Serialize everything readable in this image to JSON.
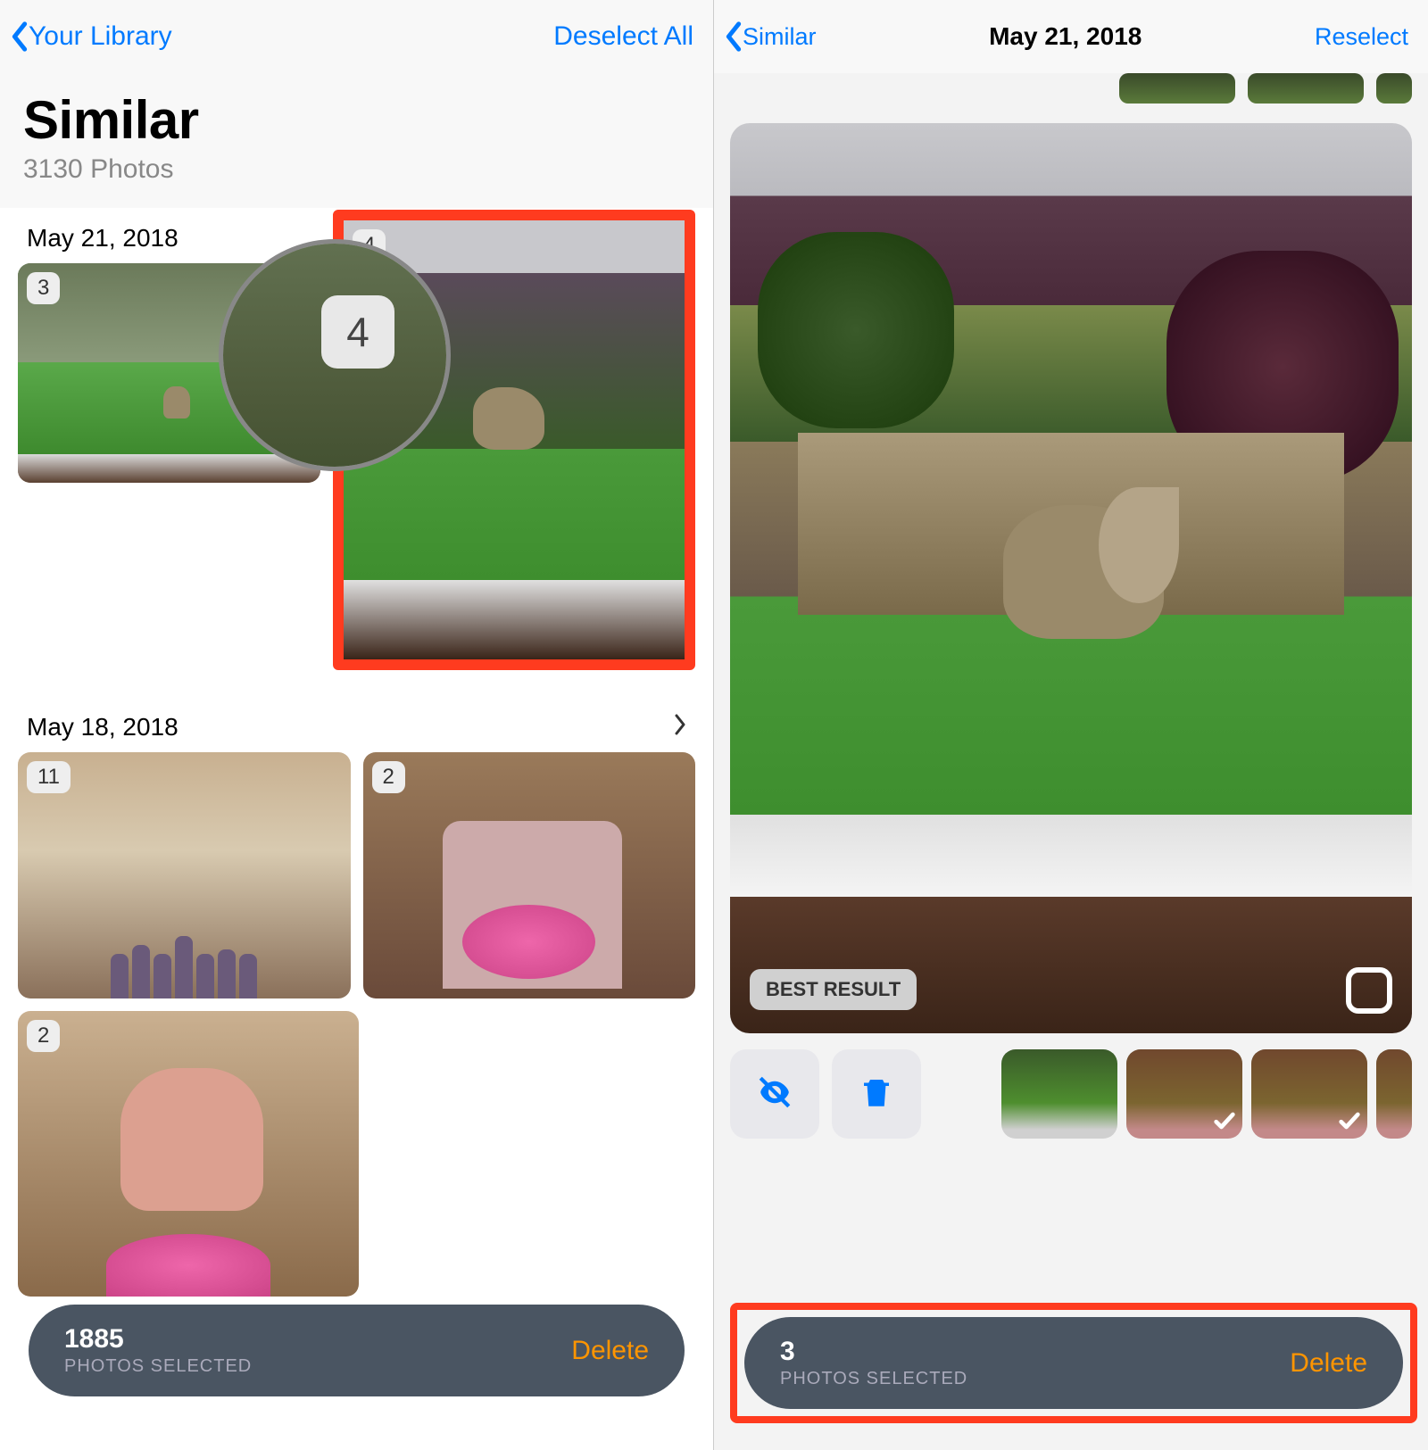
{
  "left": {
    "nav": {
      "back": "Your Library",
      "action": "Deselect All"
    },
    "hero": {
      "title": "Similar",
      "subtitle": "3130 Photos"
    },
    "sections": [
      {
        "date": "May 21, 2018",
        "thumbs": [
          {
            "count": "3"
          },
          {
            "count": "4"
          }
        ],
        "magnifier_count": "4"
      },
      {
        "date": "May 18, 2018",
        "thumbs": [
          {
            "count": "11"
          },
          {
            "count": "2"
          },
          {
            "count": "2"
          }
        ]
      }
    ],
    "delete_bar": {
      "count": "1885",
      "label": "PHOTOS SELECTED",
      "action": "Delete"
    }
  },
  "right": {
    "nav": {
      "back": "Similar",
      "title": "May 21, 2018",
      "action": "Reselect"
    },
    "best_result": "BEST RESULT",
    "variants_selected": [
      false,
      true,
      true,
      true
    ],
    "delete_bar": {
      "count": "3",
      "label": "PHOTOS SELECTED",
      "action": "Delete"
    }
  }
}
